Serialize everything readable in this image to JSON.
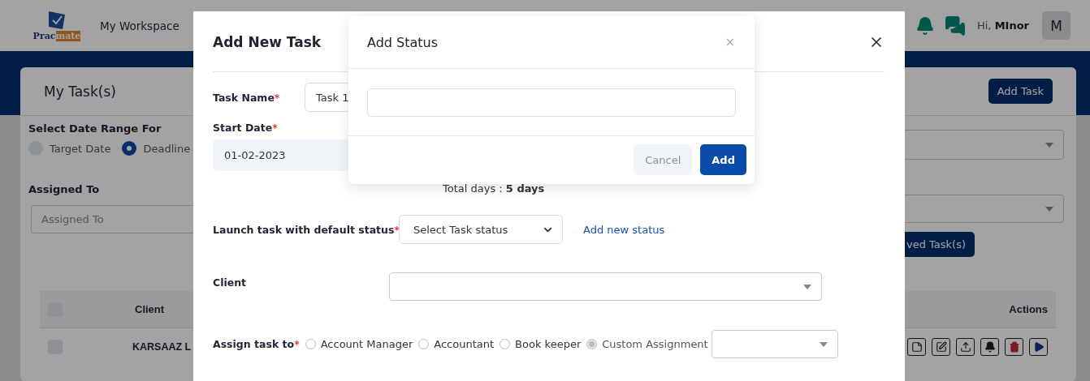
{
  "header": {
    "logo": {
      "prefix": "Prac",
      "suffix": "mate"
    },
    "nav": "My Workspace",
    "greeting": "Hi, **MInor**",
    "avatar": "M"
  },
  "page": {
    "title": "My Task(s)",
    "add_button": "Add Task",
    "date_range": {
      "label": "Select Date Range For",
      "options": [
        {
          "label": "Target Date",
          "selected": false
        },
        {
          "label": "Deadline",
          "selected": true
        }
      ]
    },
    "assigned_to": {
      "label": "Assigned To",
      "placeholder": "Assigned To"
    },
    "approved_button": "ved Task(s)",
    "table": {
      "columns": [
        "Client",
        "Actions"
      ],
      "rows": [
        {
          "client": "KARSAAZ L",
          "checked": false
        }
      ],
      "header_checked": false
    }
  },
  "task_modal": {
    "title": "Add New Task",
    "task_name": {
      "label": "Task Name",
      "required_mark": "*",
      "value": "Task 1"
    },
    "start_date": {
      "label": "Start Date",
      "required_mark": "*",
      "value": "01-02-2023"
    },
    "total_days": "Total days : **5 days**",
    "status": {
      "label": "Launch task with default status",
      "required_mark": "*",
      "value": "Select Task status",
      "link": "Add new status"
    },
    "client": {
      "label": "Client"
    },
    "assign": {
      "label": "Assign task to",
      "required_mark": "*",
      "options": [
        {
          "label": "Account Manager",
          "selected": false,
          "disabled": false
        },
        {
          "label": "Accountant",
          "selected": false,
          "disabled": false
        },
        {
          "label": "Book keeper",
          "selected": false,
          "disabled": false
        },
        {
          "label": "Custom Assignment",
          "selected": true,
          "disabled": true
        }
      ]
    }
  },
  "status_modal": {
    "title": "Add Status",
    "close": "×",
    "buttons": [
      {
        "label": "Cancel",
        "kind": "secondary"
      },
      {
        "label": "Add",
        "kind": "primary"
      }
    ]
  }
}
